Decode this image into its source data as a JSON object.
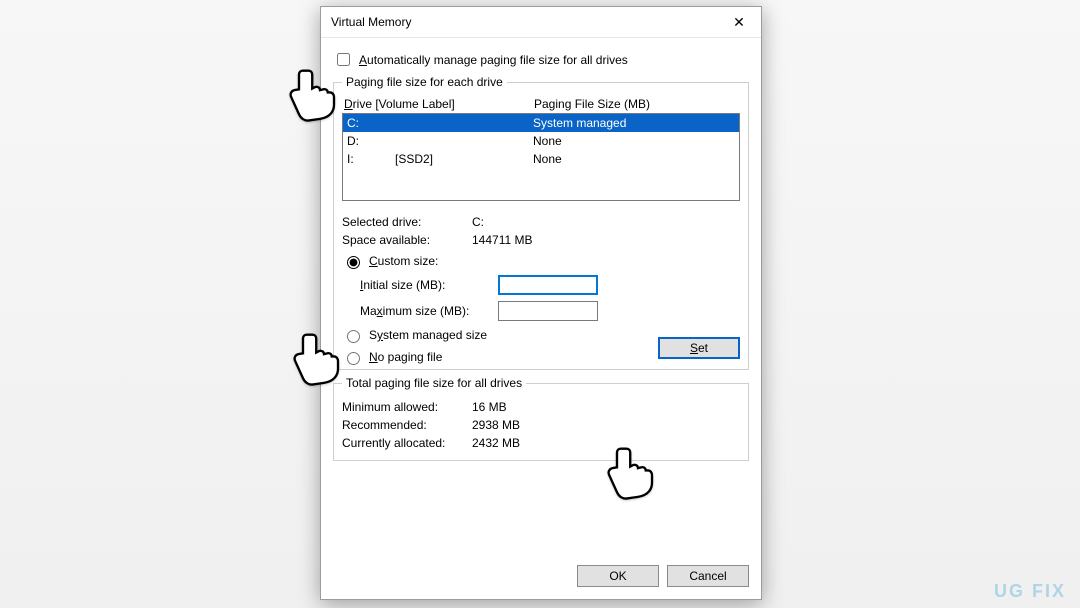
{
  "window": {
    "title": "Virtual Memory",
    "close_icon": "✕"
  },
  "auto_manage": {
    "label_pre": "",
    "label_hot": "A",
    "label_post": "utomatically manage paging file size for all drives",
    "checked": false
  },
  "each_drive": {
    "legend": "Paging file size for each drive",
    "header_drive_hot": "D",
    "header_drive_rest": "rive  [Volume Label]",
    "header_size": "Paging File Size (MB)",
    "rows": [
      {
        "letter": "C:",
        "label": "",
        "size": "System managed",
        "selected": true
      },
      {
        "letter": "D:",
        "label": "",
        "size": "None",
        "selected": false
      },
      {
        "letter": "I:",
        "label": "[SSD2]",
        "size": "None",
        "selected": false
      }
    ],
    "selected_drive_label": "Selected drive:",
    "selected_drive_value": "C:",
    "space_avail_label": "Space available:",
    "space_avail_value": "144711 MB",
    "custom_hot": "C",
    "custom_rest": "ustom size:",
    "initial_hot": "I",
    "initial_rest": "nitial size (MB):",
    "initial_value": "",
    "max_pre": "Ma",
    "max_hot": "x",
    "max_rest": "imum size (MB):",
    "max_value": "",
    "sys_pre": "S",
    "sys_hot": "y",
    "sys_rest": "stem managed size",
    "none_hot": "N",
    "none_rest": "o paging file",
    "set_hot": "S",
    "set_rest": "et"
  },
  "totals": {
    "legend": "Total paging file size for all drives",
    "min_label": "Minimum allowed:",
    "min_value": "16 MB",
    "rec_label": "Recommended:",
    "rec_value": "2938 MB",
    "cur_label": "Currently allocated:",
    "cur_value": "2432 MB"
  },
  "footer": {
    "ok": "OK",
    "cancel": "Cancel"
  },
  "watermark": "UG   FIX"
}
